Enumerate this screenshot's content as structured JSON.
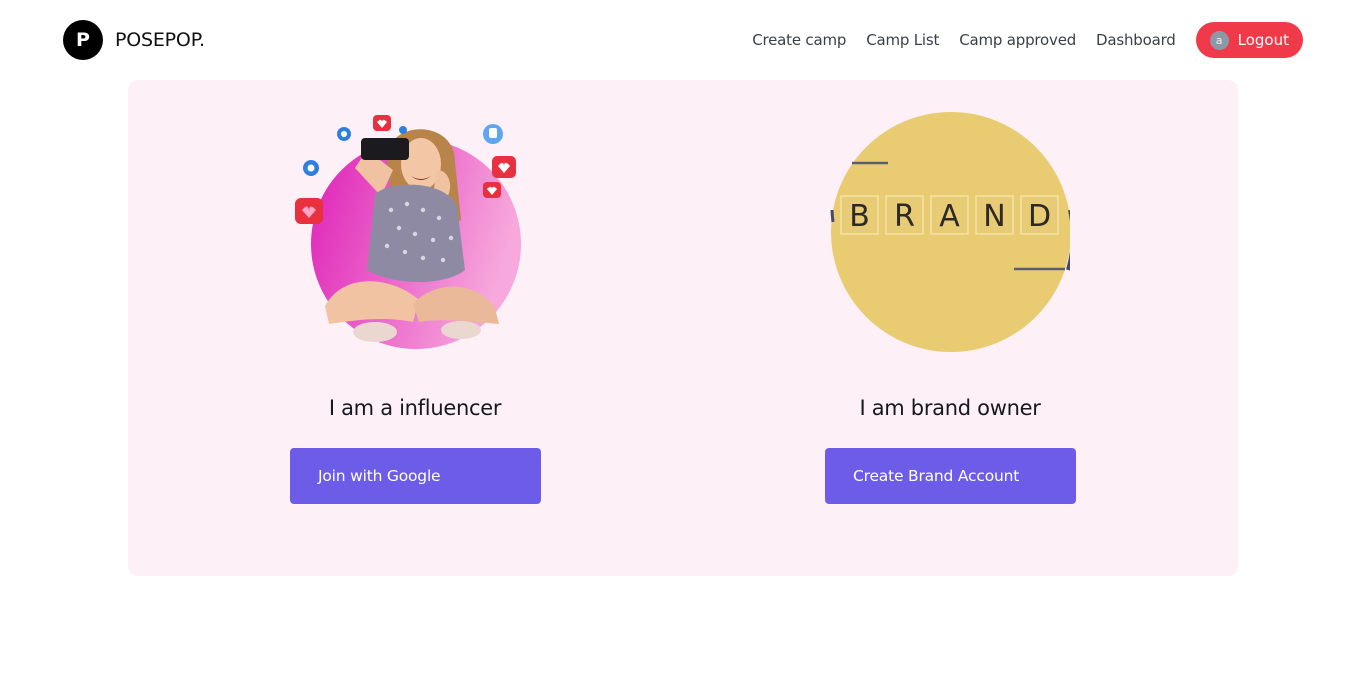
{
  "brand": {
    "mark": "P",
    "name": "POSEPOP."
  },
  "nav": {
    "items": [
      {
        "label": "Create camp"
      },
      {
        "label": "Camp List"
      },
      {
        "label": "Camp approved"
      },
      {
        "label": "Dashboard"
      }
    ],
    "logout": {
      "avatar_initial": "a",
      "label": "Logout"
    }
  },
  "roles": {
    "influencer": {
      "title": "I am a influencer",
      "button": "Join with Google"
    },
    "brand": {
      "title": "I am brand owner",
      "button": "Create Brand Account",
      "tiles": [
        "B",
        "R",
        "A",
        "N",
        "D"
      ]
    }
  },
  "colors": {
    "accent": "#6c5ce7",
    "logout": "#f03a4a",
    "card_bg": "#fdf0f6",
    "brand_circle": "#e9cb72",
    "influencer_circle": "#e23fc3"
  },
  "icons": {
    "influencer_image": "woman-selfie-illustration",
    "brand_image": "brand-letter-tiles"
  }
}
